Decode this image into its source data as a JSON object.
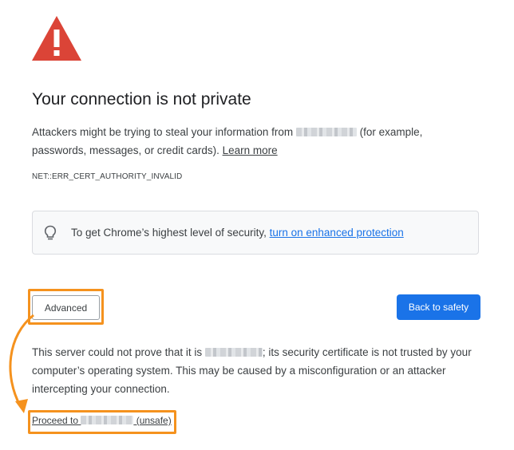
{
  "page": {
    "title": "Your connection is not private",
    "body_before": "Attackers might be trying to steal your information from ",
    "body_after": " (for example, passwords, messages, or credit cards). ",
    "learn_more": "Learn more",
    "error_code": "NET::ERR_CERT_AUTHORITY_INVALID"
  },
  "promo": {
    "text": "To get Chrome’s highest level of security, ",
    "link": "turn on enhanced protection"
  },
  "buttons": {
    "advanced": "Advanced",
    "back_to_safety": "Back to safety"
  },
  "details": {
    "before": "This server could not prove that it is ",
    "after": "; its security certificate is not trusted by your computer’s operating system. This may be caused by a misconfiguration or an attacker intercepting your connection."
  },
  "proceed": {
    "before": "Proceed to ",
    "after": " (unsafe)"
  },
  "colors": {
    "warning_red": "#db4437",
    "link_blue": "#1a73e8",
    "annotation_orange": "#f5921e"
  },
  "icons": [
    "warning-icon",
    "lightbulb-icon",
    "annotation-arrow"
  ]
}
